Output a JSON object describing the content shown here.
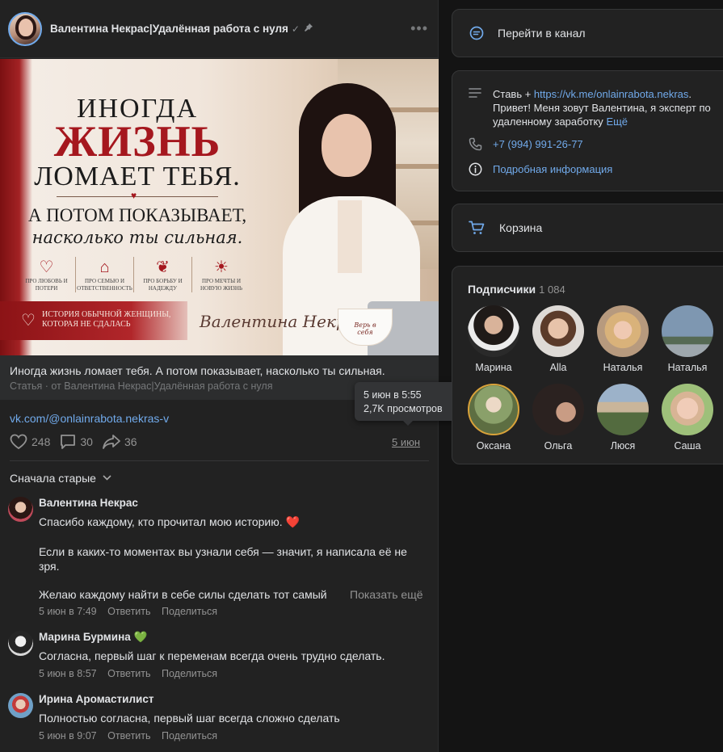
{
  "post": {
    "author": "Валентина Некрас|Удалённая работа с нуля",
    "verified_icon": "✓",
    "pin_icon": "📌",
    "more_icon": "•••",
    "banner": {
      "title_line1": "ИНОГДА",
      "title_line2": "ЖИЗНЬ",
      "title_line3": "ЛОМАЕТ ТЕБЯ.",
      "sub_line1": "А ПОТОМ ПОКАЗЫВАЕТ,",
      "sub_line2": "насколько ты сильная.",
      "icons": [
        {
          "symbol": "♡",
          "caption": "ПРО ЛЮБОВЬ И ПОТЕРИ"
        },
        {
          "symbol": "⌂",
          "caption": "ПРО СЕМЬЮ И ОТВЕТСТВЕННОСТЬ"
        },
        {
          "symbol": "❦",
          "caption": "ПРО БОРЬБУ И НАДЕЖДУ"
        },
        {
          "symbol": "☀",
          "caption": "ПРО МЕЧТЫ И НОВУЮ ЖИЗНЬ"
        }
      ],
      "ribbon_text": "ИСТОРИЯ ОБЫЧНОЙ ЖЕНЩИНЫ, КОТОРАЯ НЕ СДАЛАСЬ",
      "signature": "Валентина Некрас",
      "cup_text": "Верь в себя"
    },
    "article_title": "Иногда жизнь ломает тебя. А потом показывает, насколько ты сильная.",
    "article_source": "Статья · от Валентина Некрас|Удалённая работа с нуля",
    "link": "vk.com/@onlainrabota.nekras-v",
    "likes": "248",
    "comments": "30",
    "shares": "36",
    "date": "5 июн",
    "tooltip_line1": "5 июн в 5:55",
    "tooltip_line2": "2,7K просмотров",
    "sort_label": "Сначала старые"
  },
  "comments": [
    {
      "name": "Валентина Некрас",
      "p1": "Спасибо каждому, кто прочитал мою историю. ❤️",
      "p2": "Если в каких-то моментах вы узнали себя — значит, я написала её не зря.",
      "p3": "Желаю каждому найти в себе силы сделать тот самый",
      "show_more": "Показать ещё",
      "time": "5 июн в 7:49",
      "reply": "Ответить",
      "share": "Поделиться"
    },
    {
      "name": "Марина Бурмина 💚",
      "text": "Согласна, первый шаг к переменам всегда очень трудно сделать.",
      "time": "5 июн в 8:57",
      "reply": "Ответить",
      "share": "Поделиться"
    },
    {
      "name": "Ирина Аромастилист",
      "text": "Полностью согласна, первый шаг всегда сложно сделать",
      "time": "5 июн в 9:07",
      "reply": "Ответить",
      "share": "Поделиться"
    }
  ],
  "sidebar": {
    "go_channel": "Перейти в канал",
    "info_prefix": "Ставь + ",
    "info_link": "https://vk.me/onlainrabota.nekras",
    "info_rest": ". Привет! Меня зовут Валентина, я эксперт по удаленному заработку",
    "info_more": "Ещё",
    "phone": "+7 (994) 991-26-77",
    "details": "Подробная информация",
    "cart": "Корзина",
    "subscribers_title": "Подписчики",
    "subscribers_count": "1 084",
    "subscribers": [
      {
        "name": "Марина",
        "color": "#3a3a3a"
      },
      {
        "name": "Alla",
        "color": "#b48b6a"
      },
      {
        "name": "Наталья",
        "color": "#c9a06f"
      },
      {
        "name": "Наталья",
        "color": "#8aa2bb"
      },
      {
        "name": "Оксана",
        "color": "#7d8a5a"
      },
      {
        "name": "Ольга",
        "color": "#2a2422"
      },
      {
        "name": "Люся",
        "color": "#6d7d5e"
      },
      {
        "name": "Саша",
        "color": "#c7a48c"
      }
    ]
  }
}
